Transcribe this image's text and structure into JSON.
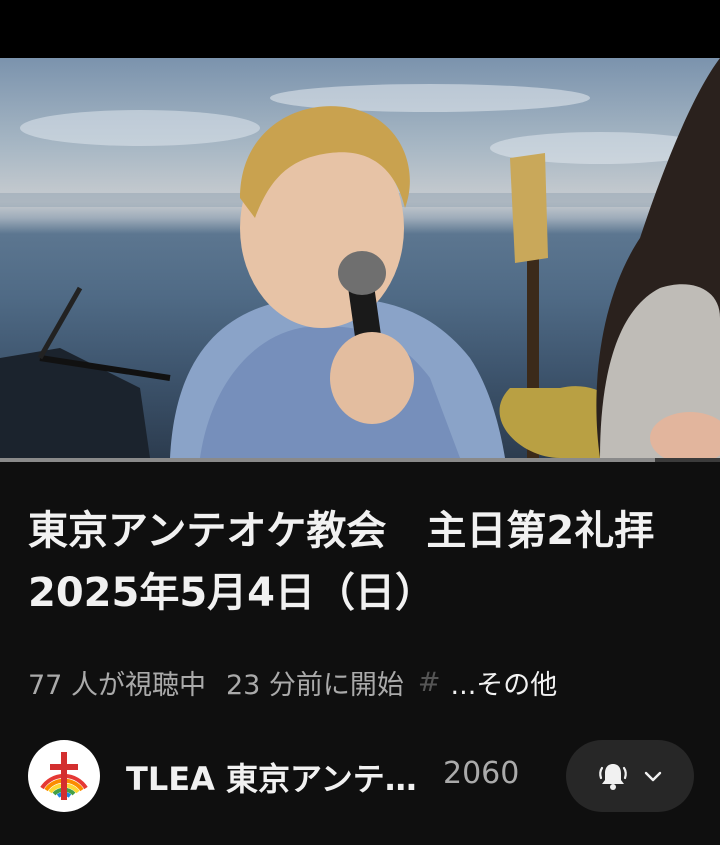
{
  "video": {
    "progress": 0.91
  },
  "title": "東京アンテオケ教会　主日第2礼拝　2025年5月4日（日）",
  "meta": {
    "live_viewers": "77 人が視聴中",
    "started": "23 分前に開始",
    "more": "...その他"
  },
  "channel": {
    "name": "TLEA 東京アンテオケ教会",
    "subscribers": "2060"
  },
  "icons": {
    "notification": "bell-ringing-icon",
    "dropdown": "chevron-down-icon"
  }
}
